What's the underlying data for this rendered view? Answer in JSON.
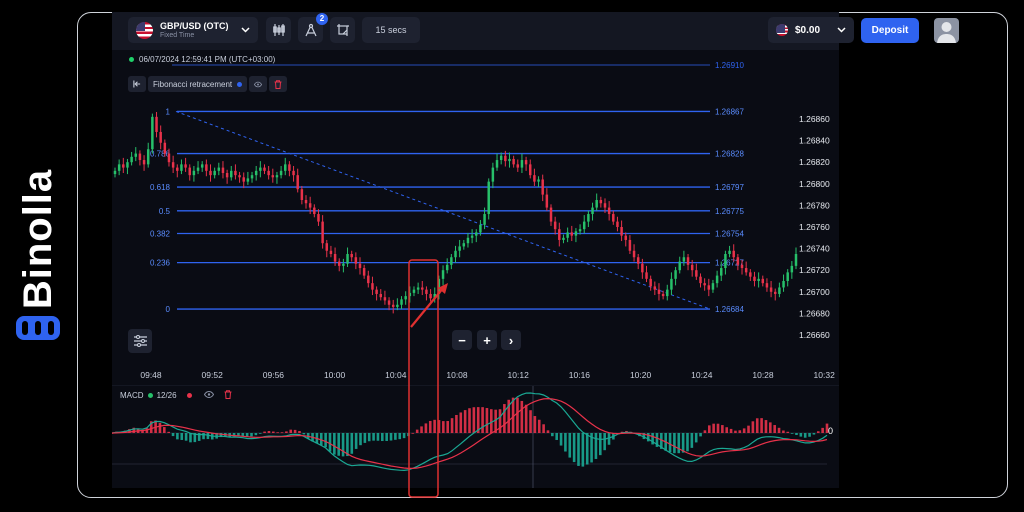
{
  "brand": {
    "name": "Binolla"
  },
  "header": {
    "pair": "GBP/USD (OTC)",
    "pair_type": "Fixed Time",
    "indicators_badge": "2",
    "interval": "15 secs",
    "balance": "$0.00",
    "deposit_label": "Deposit"
  },
  "chart": {
    "timestamp": "06/07/2024 12:59:41 PM (UTC+03:00)",
    "tool_name": "Fibonacci retracement",
    "zoom_out": "−",
    "zoom_in": "+",
    "scroll": "›"
  },
  "macd": {
    "name": "MACD",
    "params": "12/26",
    "zero_label": "0"
  },
  "colors": {
    "up": "#27c06a",
    "down": "#e8324a",
    "fib": "#2f63f0",
    "accent": "#2f63f0",
    "highlight": "#e03030"
  },
  "chart_data": {
    "type": "candlestick",
    "fib_levels": [
      {
        "ratio": "1",
        "price": "1.26867"
      },
      {
        "ratio": "0.786",
        "price": "1.26828"
      },
      {
        "ratio": "0.618",
        "price": "1.26797"
      },
      {
        "ratio": "0.5",
        "price": "1.26775"
      },
      {
        "ratio": "0.382",
        "price": "1.26754"
      },
      {
        "ratio": "0.236",
        "price": "1.26727"
      },
      {
        "ratio": "0",
        "price": "1.26684"
      }
    ],
    "fib_top_price": "1.26910",
    "y_ticks": [
      "1.26860",
      "1.26840",
      "1.26820",
      "1.26800",
      "1.26780",
      "1.26760",
      "1.26740",
      "1.26720",
      "1.26700",
      "1.26680",
      "1.26660"
    ],
    "y_range": [
      1.2665,
      1.2687
    ],
    "x_ticks": [
      "09:48",
      "09:52",
      "09:56",
      "10:00",
      "10:04",
      "10:08",
      "10:12",
      "10:16",
      "10:20",
      "10:24",
      "10:28",
      "10:32"
    ],
    "close_prices": [
      1.26812,
      1.26818,
      1.26815,
      1.2682,
      1.26825,
      1.26828,
      1.26822,
      1.26818,
      1.26832,
      1.26862,
      1.26848,
      1.26838,
      1.26828,
      1.2682,
      1.26815,
      1.26812,
      1.26818,
      1.26815,
      1.26808,
      1.26812,
      1.26815,
      1.26818,
      1.26812,
      1.26808,
      1.26812,
      1.26815,
      1.2681,
      1.26806,
      1.26812,
      1.26808,
      1.26806,
      1.26802,
      1.26805,
      1.26808,
      1.26812,
      1.26815,
      1.26812,
      1.26808,
      1.26806,
      1.26808,
      1.26812,
      1.26818,
      1.26812,
      1.26808,
      1.26795,
      1.26785,
      1.26782,
      1.26778,
      1.26772,
      1.26765,
      1.26745,
      1.26738,
      1.26735,
      1.26728,
      1.26724,
      1.26726,
      1.26735,
      1.26732,
      1.26726,
      1.26722,
      1.26715,
      1.26708,
      1.26702,
      1.26698,
      1.26695,
      1.26692,
      1.26688,
      1.26686,
      1.26688,
      1.26693,
      1.26696,
      1.26699,
      1.26702,
      1.26704,
      1.26702,
      1.26698,
      1.26694,
      1.26698,
      1.26712,
      1.2672,
      1.26725,
      1.26732,
      1.26738,
      1.26742,
      1.26745,
      1.2675,
      1.26752,
      1.26755,
      1.26762,
      1.26772,
      1.26802,
      1.26815,
      1.26822,
      1.26826,
      1.26821,
      1.26823,
      1.26818,
      1.26815,
      1.26822,
      1.26818,
      1.26808,
      1.26802,
      1.26804,
      1.2679,
      1.26778,
      1.26765,
      1.26758,
      1.26748,
      1.2675,
      1.26755,
      1.26752,
      1.26756,
      1.26758,
      1.26765,
      1.26772,
      1.26778,
      1.26785,
      1.26782,
      1.26778,
      1.26772,
      1.26765,
      1.2676,
      1.26752,
      1.26748,
      1.26738,
      1.26732,
      1.26726,
      1.26718,
      1.26712,
      1.26705,
      1.26702,
      1.26698,
      1.26696,
      1.26702,
      1.26712,
      1.2672,
      1.26728,
      1.26732,
      1.26725,
      1.2672,
      1.26714,
      1.26708,
      1.26706,
      1.26702,
      1.26708,
      1.26715,
      1.26722,
      1.26735,
      1.26738,
      1.26732,
      1.26725,
      1.26722,
      1.26718,
      1.26714,
      1.2671,
      1.26712,
      1.26708,
      1.26704,
      1.267,
      1.26698,
      1.26704,
      1.2671,
      1.26718,
      1.26724,
      1.26735
    ]
  }
}
